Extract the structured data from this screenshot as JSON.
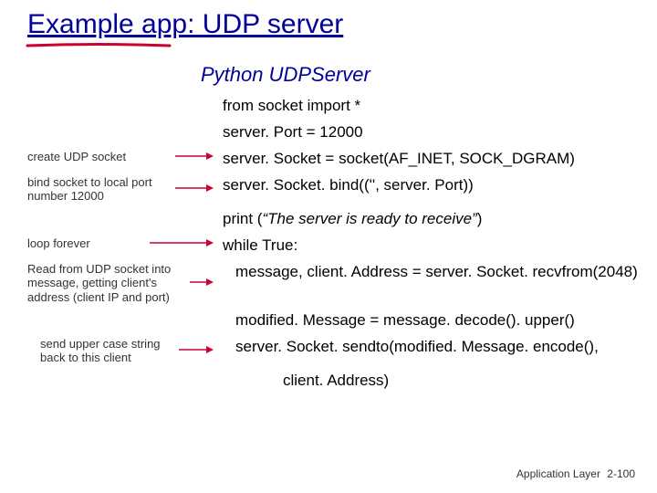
{
  "title": "Example app: UDP server",
  "subtitle": "Python UDPServer",
  "code": {
    "l1": "from socket import *",
    "l2": "server. Port = 12000",
    "l3": "server. Socket = socket(AF_INET, SOCK_DGRAM)",
    "l4": "server. Socket. bind(('', server. Port))",
    "l5": "print (“The server is ready to receive”)",
    "l6": "while True:",
    "l7": "message, client. Address = server. Socket. recvfrom(2048)",
    "l8": "modified. Message = message. decode(). upper()",
    "l9": "server. Socket. sendto(modified. Message. encode(),",
    "l10": "client. Address)"
  },
  "annot": {
    "a1": "create UDP socket",
    "a2": "bind socket to local port number 12000",
    "a3": "loop forever",
    "a4": "Read from UDP socket into message, getting client's address (client IP and port)",
    "a5": "send upper case string back to this client"
  },
  "footer": {
    "label": "Application Layer",
    "page": "2-100"
  }
}
